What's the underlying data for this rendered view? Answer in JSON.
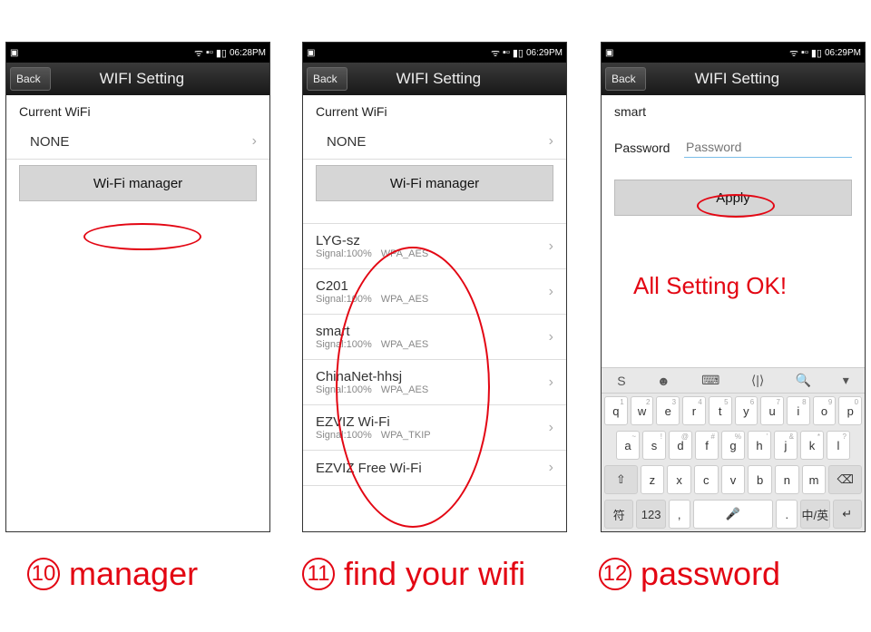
{
  "status": {
    "time1": "06:28PM",
    "time2": "06:29PM",
    "time3": "06:29PM"
  },
  "titlebar": {
    "back": "Back",
    "title": "WIFI Setting"
  },
  "p1": {
    "current_label": "Current WiFi",
    "current_value": "NONE",
    "manager_btn": "Wi-Fi manager"
  },
  "p2": {
    "current_label": "Current WiFi",
    "current_value": "NONE",
    "manager_btn": "Wi-Fi manager",
    "networks": [
      {
        "ssid": "LYG-sz",
        "signal": "Signal:100%",
        "sec": "WPA_AES"
      },
      {
        "ssid": "C201",
        "signal": "Signal:100%",
        "sec": "WPA_AES"
      },
      {
        "ssid": "smart",
        "signal": "Signal:100%",
        "sec": "WPA_AES"
      },
      {
        "ssid": "ChinaNet-hhsj",
        "signal": "Signal:100%",
        "sec": "WPA_AES"
      },
      {
        "ssid": "EZVIZ Wi-Fi",
        "signal": "Signal:100%",
        "sec": "WPA_TKIP"
      },
      {
        "ssid": "EZVIZ Free Wi-Fi",
        "signal": "",
        "sec": ""
      }
    ]
  },
  "p3": {
    "ssid": "smart",
    "pw_label": "Password",
    "pw_placeholder": "Password",
    "apply": "Apply"
  },
  "annotations": {
    "ok": "All Setting OK!",
    "cap1_num": "10",
    "cap1_txt": "manager",
    "cap2_num": "11",
    "cap2_txt": "find  your wifi",
    "cap3_num": "12",
    "cap3_txt": "password"
  },
  "keyboard": {
    "strip_icons": [
      "S",
      "☻",
      "⌨",
      "⟨|⟩",
      "🔍",
      "▾"
    ],
    "row1": [
      "q",
      "w",
      "e",
      "r",
      "t",
      "y",
      "u",
      "i",
      "o",
      "p"
    ],
    "hints1": [
      "1",
      "2",
      "3",
      "4",
      "5",
      "6",
      "7",
      "8",
      "9",
      "0"
    ],
    "row2": [
      "a",
      "s",
      "d",
      "f",
      "g",
      "h",
      "j",
      "k",
      "l"
    ],
    "hints2": [
      "~",
      "!",
      "@",
      "#",
      "%",
      "'",
      "&",
      "*",
      "?"
    ],
    "row3_shift": "⇧",
    "row3": [
      "z",
      "x",
      "c",
      "v",
      "b",
      "n",
      "m"
    ],
    "row3_back": "⌫",
    "row4_sym": "符",
    "row4_num": "123",
    "row4_comma": ",",
    "row4_mic": "🎤",
    "row4_dot": ".",
    "row4_lang": "中/英",
    "row4_enter": "↵"
  }
}
